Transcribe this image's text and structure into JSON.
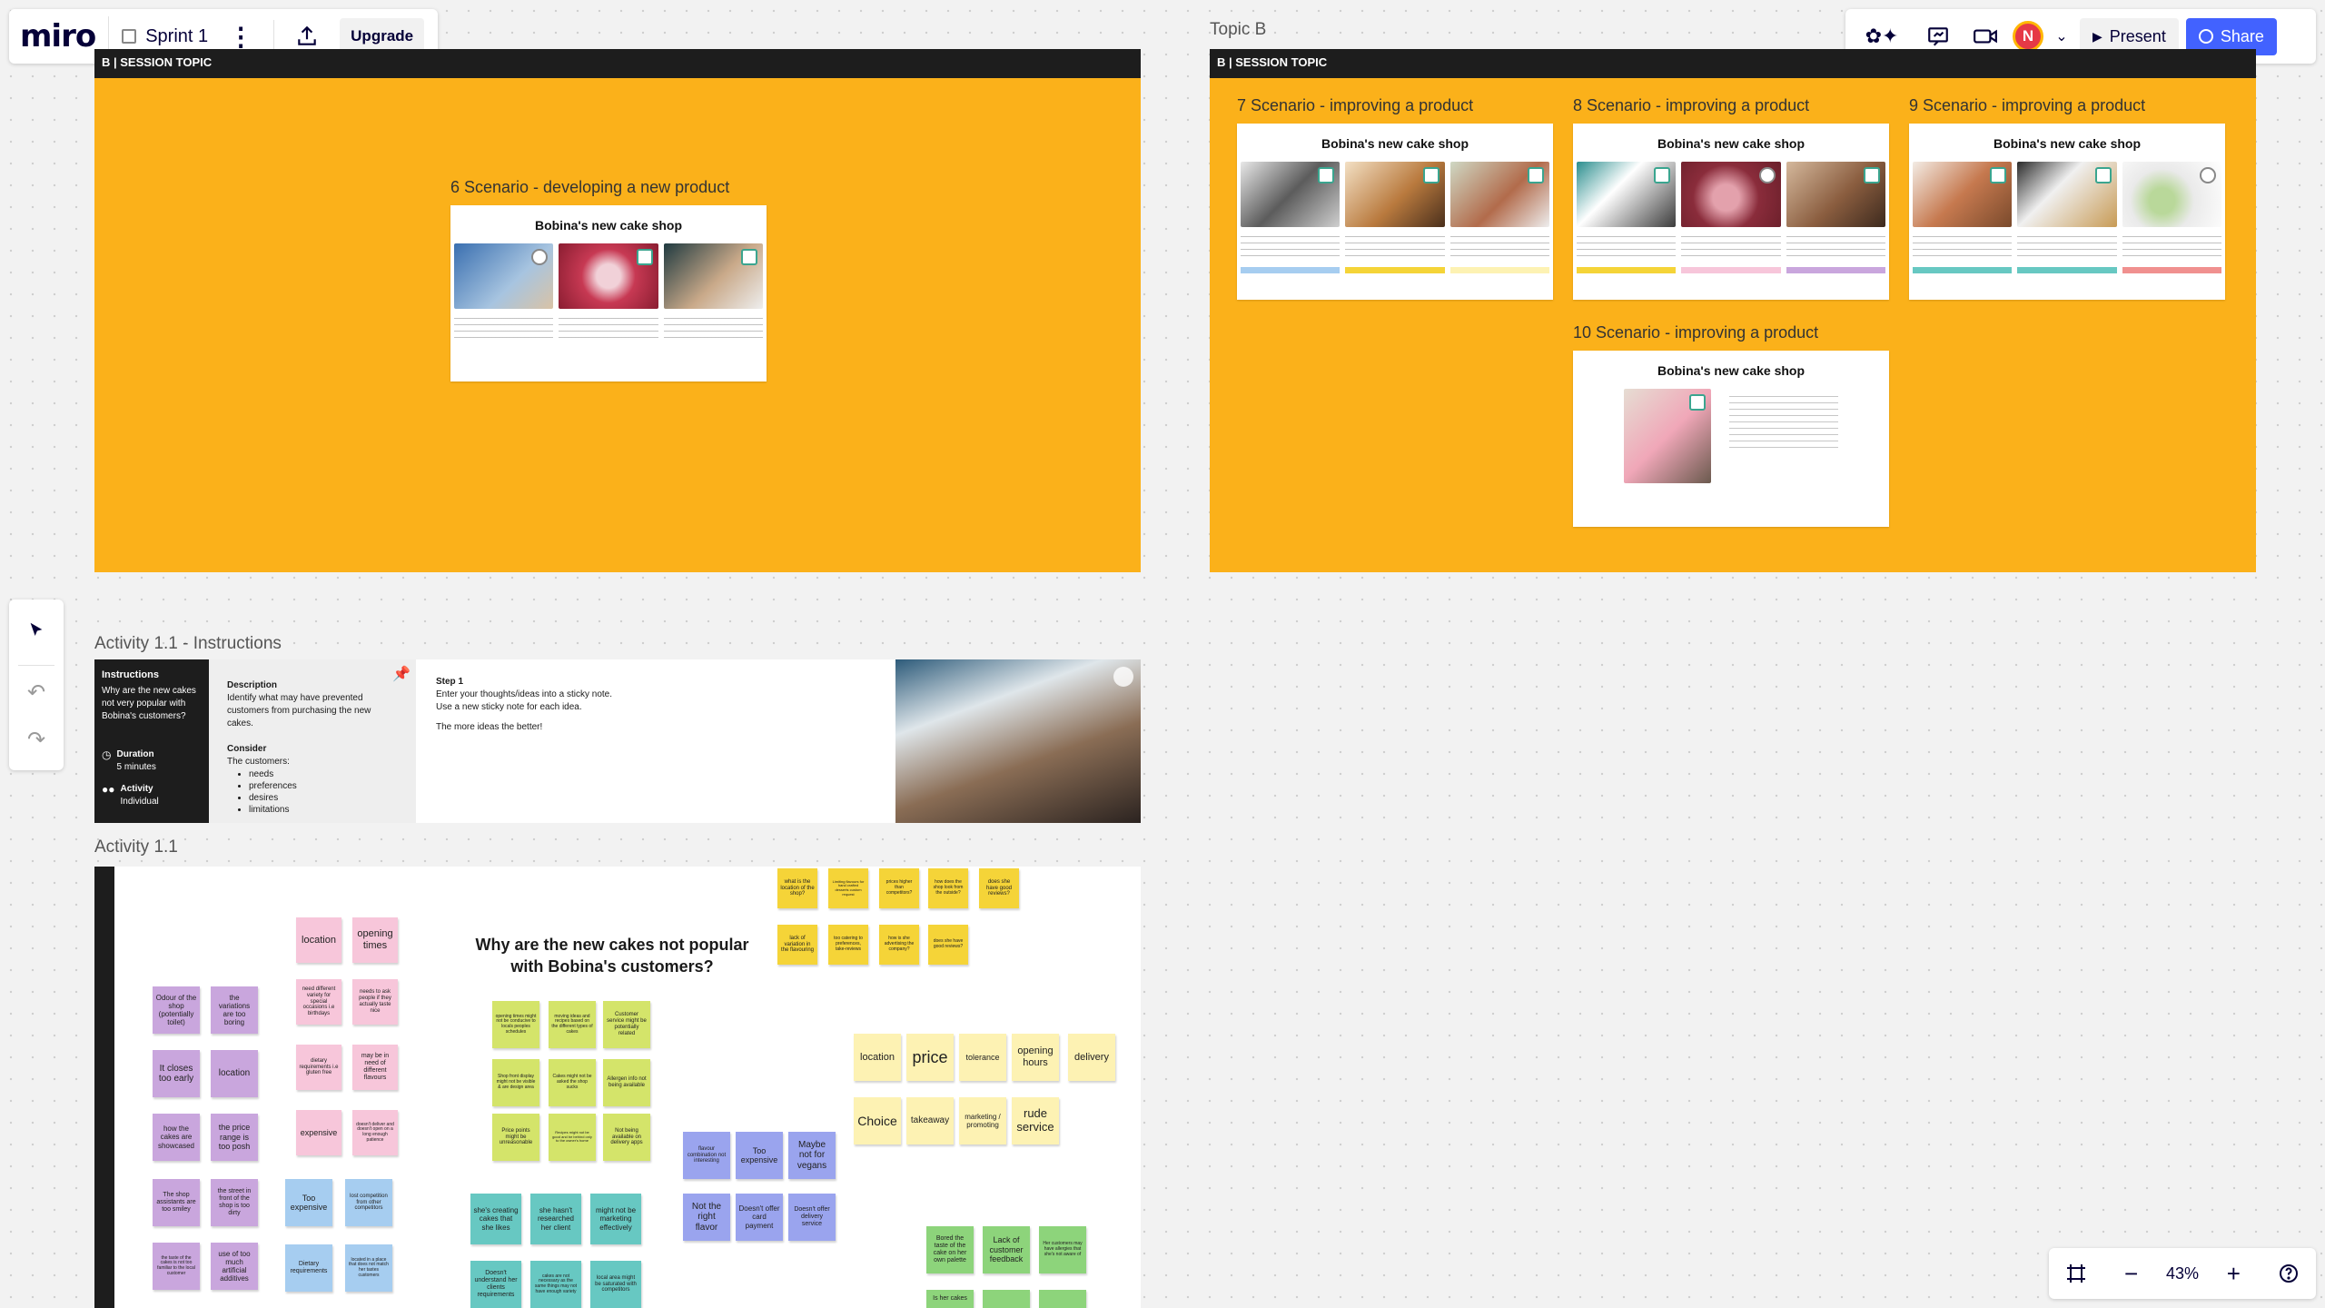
{
  "toolbar": {
    "logo": "miro",
    "board_name": "Sprint 1",
    "upgrade_label": "Upgrade",
    "present_label": "Present",
    "share_label": "Share",
    "avatar_initial": "N"
  },
  "topic_b": {
    "label": "Topic B"
  },
  "frames": {
    "session_topic_left": "B | SESSION TOPIC",
    "session_topic_right": "B | SESSION TOPIC"
  },
  "scenarios": {
    "s6": {
      "label": "6 Scenario - developing a new product",
      "title": "Bobina's new cake shop"
    },
    "s7": {
      "label": "7 Scenario - improving a product",
      "title": "Bobina's new cake shop"
    },
    "s8": {
      "label": "8 Scenario - improving a product",
      "title": "Bobina's new cake shop"
    },
    "s9": {
      "label": "9 Scenario - improving a product",
      "title": "Bobina's new cake shop"
    },
    "s10": {
      "label": "10 Scenario - improving a product",
      "title": "Bobina's new cake shop"
    }
  },
  "instructions_frame": {
    "label": "Activity 1.1 - Instructions",
    "heading": "Instructions",
    "question": "Why are the new cakes not very popular with Bobina's customers?",
    "duration_label": "Duration",
    "duration_value": "5 minutes",
    "activity_label": "Activity",
    "activity_value": "Individual",
    "description_label": "Description",
    "description_text": "Identify what may have prevented customers from purchasing the new cakes.",
    "consider_label": "Consider",
    "consider_intro": "The customers:",
    "consider_items": [
      "needs",
      "preferences",
      "desires",
      "limitations"
    ],
    "step_label": "Step 1",
    "step_text": "Enter your thoughts/ideas into a sticky note. Use a new sticky note for each idea.",
    "step_note": "The more ideas the better!"
  },
  "activity_frame": {
    "label": "Activity 1.1",
    "question": "Why are the new cakes not popular with Bobina's customers?"
  },
  "stickies": {
    "pink": [
      "location",
      "opening times",
      "need different variety for special occasions i.e birthdays",
      "needs to ask people if they actually taste nice",
      "dietary requirements i.e gluten free",
      "may be in need of different flavours",
      "expensive",
      "doesn't deliver and doesn't open on a long enough patience"
    ],
    "purple": [
      "Odour of the shop (potentially toilet)",
      "the variations are too boring",
      "It closes too early",
      "location",
      "how the cakes are showcased",
      "the price range is too posh",
      "The shop assistants are too smiley",
      "the street in front of the shop is too dirty",
      "the taste of the cakes is not too familiar to the local customer",
      "use of too much artificial additives"
    ],
    "blue": [
      "Too expensive",
      "lost competition from other competitors",
      "Dietary requirements",
      "located in a place that does not match her tastes customers"
    ],
    "lime": [
      "opening times might not be conducive to locals peoples schedules",
      "moving ideas and recipes based on the different types of cakes",
      "Customer service might be potentially related",
      "Shop front display might not be visible & are design area",
      "Cakes might not be asked the shop sucks",
      "Allergen info not being available",
      "Price points might be unreasonable",
      "Recipes might not be good and be behind only to the owner's home",
      "Not being available on delivery apps"
    ],
    "teal": [
      "she's creating cakes that she likes",
      "she hasn't researched her client",
      "might not be marketing effectively",
      "Doesn't understand her clients requirements",
      "cakes are not necessary as the same things may not have enough variety",
      "local area might be saturated with competitors"
    ],
    "violet": [
      "flavour combination not interesting",
      "Too expensive",
      "Maybe not for vegans",
      "Not the right flavor",
      "Doesn't offer card payment",
      "Doesn't offer delivery service"
    ],
    "yellow": [
      "what is the location of the shop?",
      "Limiting flavours for hand crafted desserts custom request",
      "prices higher than competitors?",
      "how does the shop look from the outside?",
      "does she have good reviews?",
      "lack of variation in the flavouring",
      "too catering to preferences, take-reviews",
      "how is she advertising the company?",
      "does she have good reviews?"
    ],
    "pale": [
      "location",
      "price",
      "tolerance",
      "opening hours",
      "delivery",
      "Choice",
      "takeaway",
      "marketing / promoting",
      "rude service"
    ],
    "green": [
      "Bored the taste of the cake on her own palette",
      "Lack of customer feedback",
      "Her customers may have allergies that she's not aware of",
      "Is her cakes"
    ]
  },
  "zoom": {
    "level": "43%"
  },
  "colors": {
    "frame_orange": "#fbb11a",
    "miro_blue": "#4262ff",
    "dark_bar": "#1d1d1d"
  }
}
